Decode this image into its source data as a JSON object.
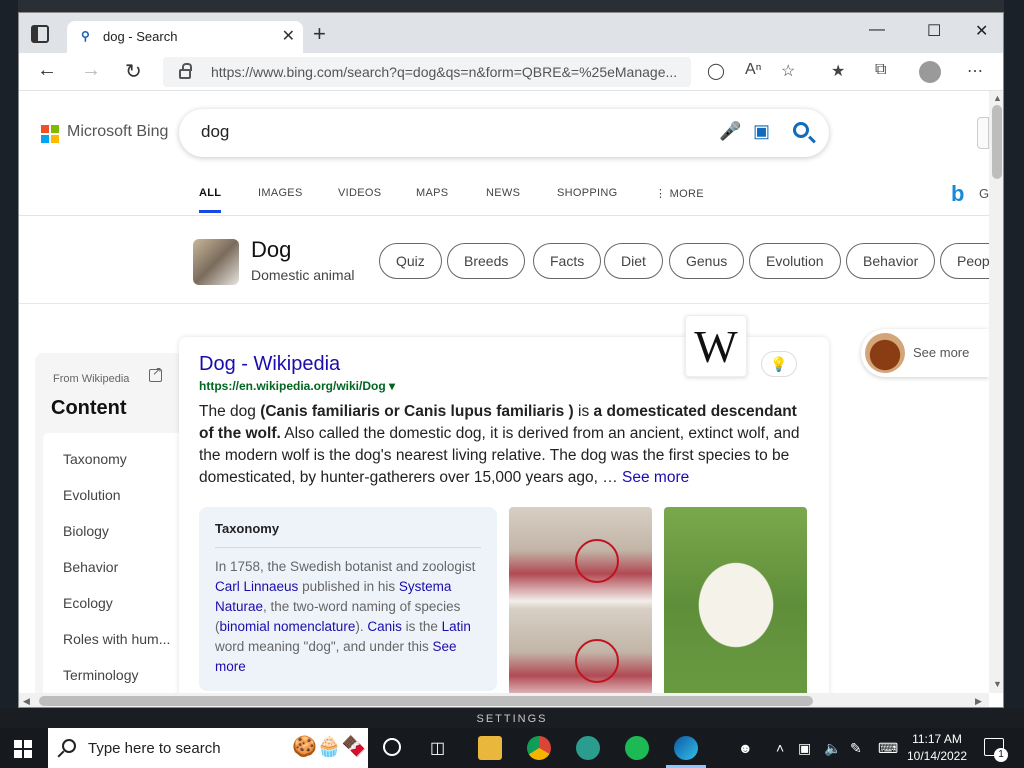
{
  "browser": {
    "tab_title": "dog - Search",
    "tab_favicon": "search-icon",
    "url": "https://www.bing.com/search?q=dog&qs=n&form=QBRE&=%25eManage...",
    "minimize": "—",
    "maximize": "☐",
    "close": "✕",
    "new_tab": "+"
  },
  "bing": {
    "logo_text": "Microsoft Bing",
    "logo_colors": [
      "#f25022",
      "#7fba00",
      "#00a4ef",
      "#ffb900"
    ],
    "query": "dog",
    "nav_tabs": [
      "ALL",
      "IMAGES",
      "VIDEOS",
      "MAPS",
      "NEWS",
      "SHOPPING",
      "⋮ MORE"
    ],
    "right_g": "G"
  },
  "entity": {
    "title": "Dog",
    "subtitle": "Domestic animal",
    "chips": [
      "Quiz",
      "Breeds",
      "Facts",
      "Diet",
      "Genus",
      "Evolution",
      "Behavior",
      "Peop"
    ]
  },
  "sidebar": {
    "from": "From Wikipedia",
    "content_title": "Content",
    "items": [
      "Taxonomy",
      "Evolution",
      "Biology",
      "Behavior",
      "Ecology",
      "Roles with hum...",
      "Terminology"
    ]
  },
  "result": {
    "title": "Dog - Wikipedia",
    "url": "https://en.wikipedia.org/wiki/Dog",
    "url_caret": "▾",
    "wiki_logo": "W",
    "text_pre": "The dog ",
    "text_bold1": "(Canis familiaris or Canis lupus familiaris )",
    "text_mid": " is ",
    "text_bold2": "a domesticated descendant of the wolf.",
    "text_rest": " Also called the domestic dog, it is derived from an ancient, extinct wolf, and the modern wolf is the dog's nearest living relative. The dog was the first species to be domesticated, by hunter-gatherers over 15,000 years ago, … ",
    "see_more": "See more"
  },
  "taxonomy": {
    "title": "Taxonomy",
    "t1": "In 1758, the Swedish botanist and zoologist ",
    "l1": "Carl Linnaeus",
    "t2": " published in his ",
    "l2": "Systema Naturae",
    "t3": ", the two-word naming of species (",
    "l3": "binomial nomenclature",
    "t4": "). ",
    "l4": "Canis",
    "t5": " is the ",
    "l5": "Latin",
    "t6": " word meaning \"dog\", and under this ",
    "l6": "See more"
  },
  "see_more_pill": "See more",
  "taskbar": {
    "search_placeholder": "Type here to search",
    "time": "11:17 AM",
    "date": "10/14/2022",
    "notifications": "1",
    "settings_label": "SETTINGS"
  }
}
